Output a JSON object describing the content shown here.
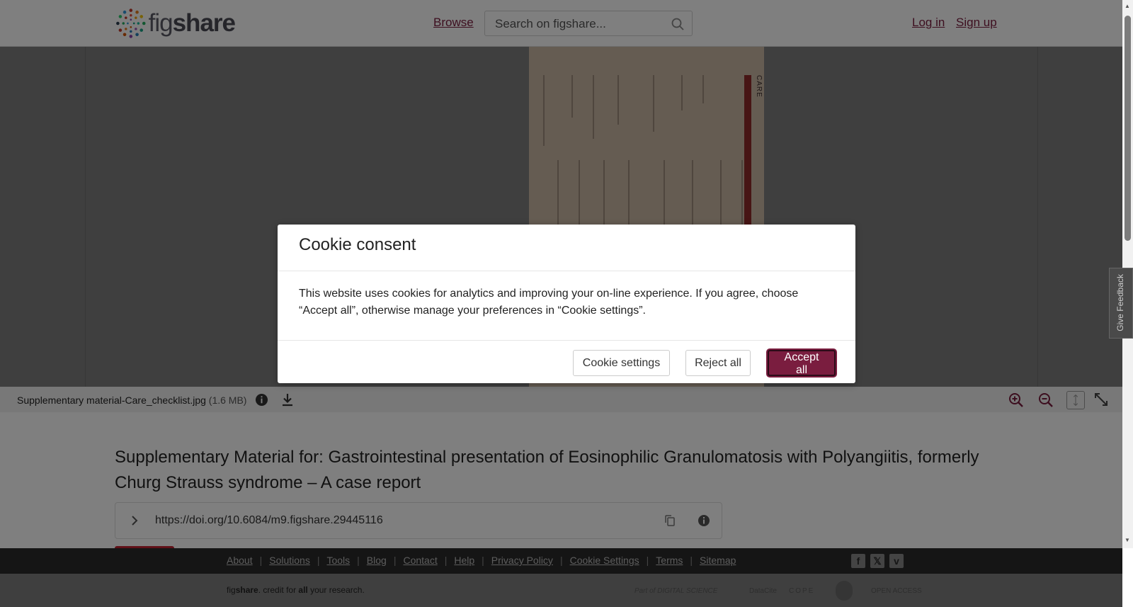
{
  "header": {
    "logo_fig": "fig",
    "logo_share": "share",
    "browse_label": "Browse",
    "search_placeholder": "Search on figshare...",
    "login_label": "Log in",
    "signup_label": "Sign up"
  },
  "viewer": {
    "document_title_vertical": "CARE"
  },
  "file_bar": {
    "file_name": "Supplementary material-Care_checklist.jpg",
    "file_size": "(1.6 MB)"
  },
  "article": {
    "title": "Supplementary Material for: Gastrointestinal presentation of Eosinophilic Granulomatosis with Polyangiitis, formerly Churg Strauss syndrome – A case report",
    "doi": "https://doi.org/10.6084/m9.figshare.29445116"
  },
  "footer": {
    "links": [
      "About",
      "Solutions",
      "Tools",
      "Blog",
      "Contact",
      "Help",
      "Privacy Policy",
      "Cookie Settings",
      "Terms",
      "Sitemap"
    ],
    "credit_prefix": "fig",
    "credit_brand": "share",
    "credit_mid": ". credit for ",
    "credit_all": "all",
    "credit_suffix": " your research.",
    "partners": [
      "Part of DIGITAL SCIENCE",
      "DataCite",
      "COPE",
      "",
      "OPEN ACCESS"
    ]
  },
  "feedback": {
    "label": "Give Feedback"
  },
  "modal": {
    "title": "Cookie consent",
    "body": "This website uses cookies for analytics and improving your on-line experience. If you agree, choose “Accept all”, otherwise manage your preferences in “Cookie settings”.",
    "settings_label": "Cookie settings",
    "reject_label": "Reject all",
    "accept_label": "Accept all"
  },
  "colors": {
    "brand": "#7a1d3f",
    "accent_red": "#c0202f"
  }
}
